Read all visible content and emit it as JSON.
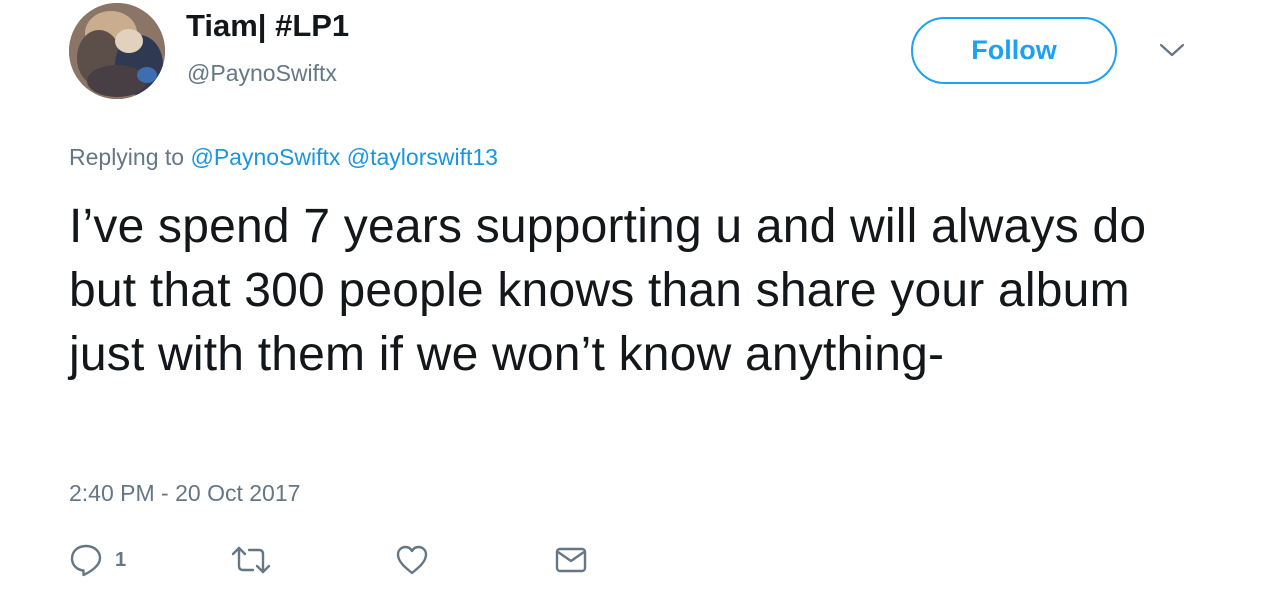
{
  "tweet": {
    "author": {
      "display_name": "Tiam| #LP1",
      "handle": "@PaynoSwiftx"
    },
    "follow_label": "Follow",
    "replying_prefix": "Replying to",
    "replying_to": [
      "@PaynoSwiftx",
      "@taylorswift13"
    ],
    "text": "I’ve spend 7 years supporting u and will always do but that 300 people knows than share your album just with them if we won’t know anything-",
    "timestamp": "2:40 PM - 20 Oct 2017",
    "actions": {
      "reply_count": "1",
      "reply_icon": "reply-icon",
      "retweet_icon": "retweet-icon",
      "like_icon": "heart-icon",
      "message_icon": "envelope-icon"
    }
  },
  "colors": {
    "accent": "#1da1f2",
    "link": "#1b95e0",
    "muted": "#657786",
    "text": "#14171a"
  }
}
